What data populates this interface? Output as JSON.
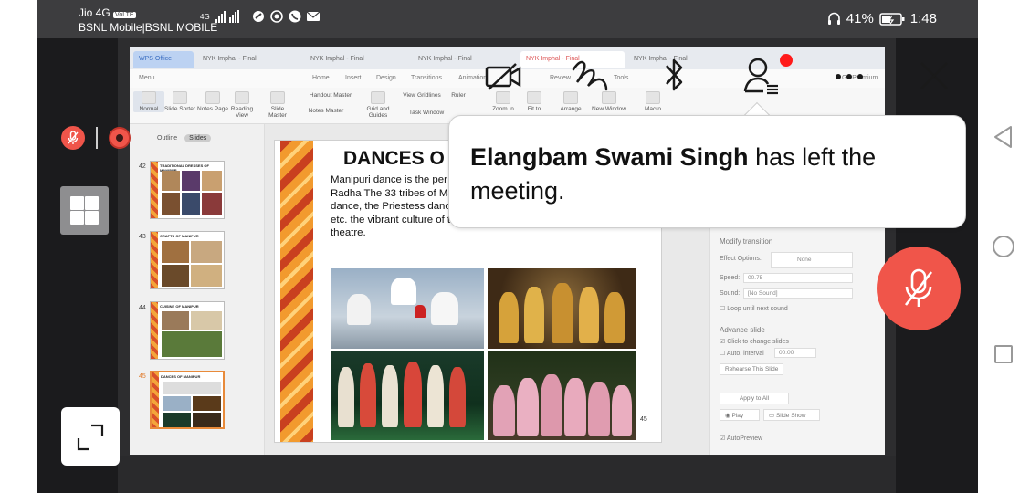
{
  "status_bar": {
    "carrier_line1": "Jio 4G",
    "volte": "VoLTE",
    "carrier_line2": "BSNL Mobile|BSNL MOBILE",
    "network": "4G",
    "battery": "41%",
    "time": "1:48"
  },
  "shared_screen": {
    "app_tabs": {
      "brand": "WPS Office",
      "docs": [
        "NYK Imphal - Final",
        "NYK Imphal - Final",
        "NYK Imphal - Final",
        "NYK Imphal - Final",
        "NYK Imphal - Final"
      ]
    },
    "menu": [
      "Menu",
      "Home",
      "Insert",
      "Design",
      "Transitions",
      "Animation",
      "Review",
      "Tools",
      "Go Premium"
    ],
    "ribbon": [
      "Normal",
      "Slide Sorter",
      "Notes Page",
      "Reading View",
      "Slide Master",
      "Notes Master",
      "Grid and Guides",
      "Task Window",
      "Zoom In",
      "Fit to",
      "Arrange",
      "New Window",
      "Macro"
    ],
    "ribbon_checks": [
      "Handout Master",
      "View Gridlines",
      "Ruler"
    ],
    "outline_tab": "Outline",
    "slides_tab": "Slides",
    "thumbnails": [
      {
        "num": "42",
        "title": "TRADITIONAL DRESSES OF MANIPUR"
      },
      {
        "num": "43",
        "title": "CRAFTS OF MANIPUR"
      },
      {
        "num": "44",
        "title": "CUISINE OF MANIPUR"
      },
      {
        "num": "45",
        "title": "DANCES OF MANIPUR"
      }
    ],
    "add_slide": "+",
    "slide": {
      "title": "DANCES O",
      "body": "Manipuri dance is the per The dance is often devot Lila (Love story of Radha The 33 tribes of Manipur h Haraoba, Pung cholom, Mao Naga dance, the Priestess dance of Maibe Jagoi, Thangal Surang dance etc. the vibrant culture of the Manipuris is reflected in their dance and theatre.",
      "number": "45"
    },
    "transition_panel": {
      "heading": "Modify transition",
      "effect_label": "Effect Options:",
      "effect_value": "None",
      "speed_label": "Speed:",
      "speed_value": "00.75",
      "sound_label": "Sound:",
      "sound_value": "[No Sound]",
      "loop_label": "Loop until next sound",
      "advance_heading": "Advance slide",
      "click_label": "Click to change slides",
      "auto_label": "Auto, interval",
      "auto_value": "00:00",
      "rehearse": "Rehearse This Slide",
      "apply_all": "Apply to All",
      "play": "Play",
      "slideshow": "Slide Show",
      "autopreview": "AutoPreview"
    }
  },
  "notification": {
    "name": "Elangbam Swami Singh",
    "message": " has left the meeting."
  },
  "colors": {
    "accent_red": "#f0554a",
    "hand_raise": "#ff1a1a"
  },
  "icons": {
    "video": "video-off-icon",
    "draw": "scribble-icon",
    "bluetooth": "bluetooth-icon",
    "participants": "participants-icon",
    "more": "more-icon",
    "close": "close-icon",
    "mic": "mic-off-icon"
  }
}
